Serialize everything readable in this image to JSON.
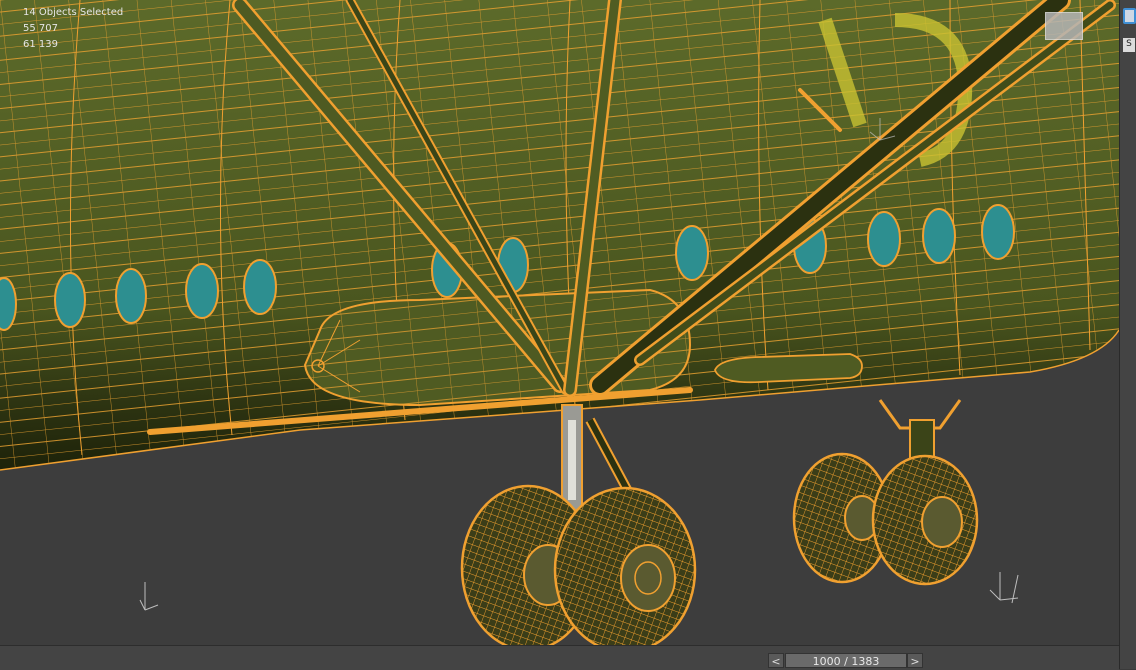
{
  "viewport": {
    "stats": {
      "selection": "14 Objects Selected",
      "polys": "55 707",
      "verts": "61 139"
    },
    "colors": {
      "background": "#3d3d3d",
      "fuselage": "#4e5a22",
      "wire_selected": "#f0a030",
      "window_glass": "#2d8f90",
      "tire": "#3b3d18"
    }
  },
  "timeline": {
    "prev_label": "<",
    "frame_readout": "1000 / 1383",
    "next_label": ">"
  },
  "side_panel": {
    "button_label": "S"
  }
}
